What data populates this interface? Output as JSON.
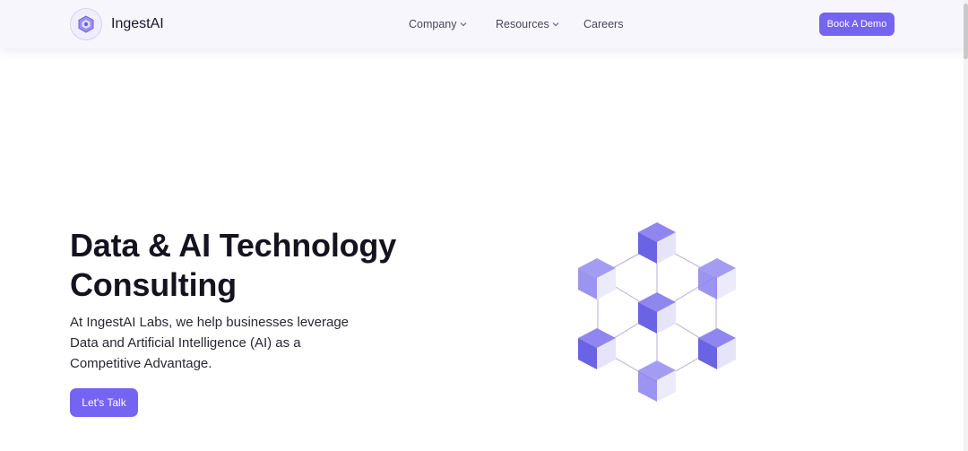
{
  "header": {
    "brand": "IngestAI",
    "nav": [
      {
        "label": "Company",
        "has_dropdown": true
      },
      {
        "label": "Resources",
        "has_dropdown": true
      },
      {
        "label": "Careers",
        "has_dropdown": false
      }
    ],
    "cta_label": "Book A Demo"
  },
  "hero": {
    "title_line1": "Data & AI Technology",
    "title_line2": "Consulting",
    "subtitle": "At IngestAI Labs, we help businesses leverage Data and Artificial Intelligence (AI) as a Competitive Advantage.",
    "cta_label": "Let's Talk",
    "graphic_icon": "cube-network-illustration"
  },
  "colors": {
    "accent": "#7563f2",
    "header_bg": "#f8f6fd",
    "title": "#15131f"
  }
}
